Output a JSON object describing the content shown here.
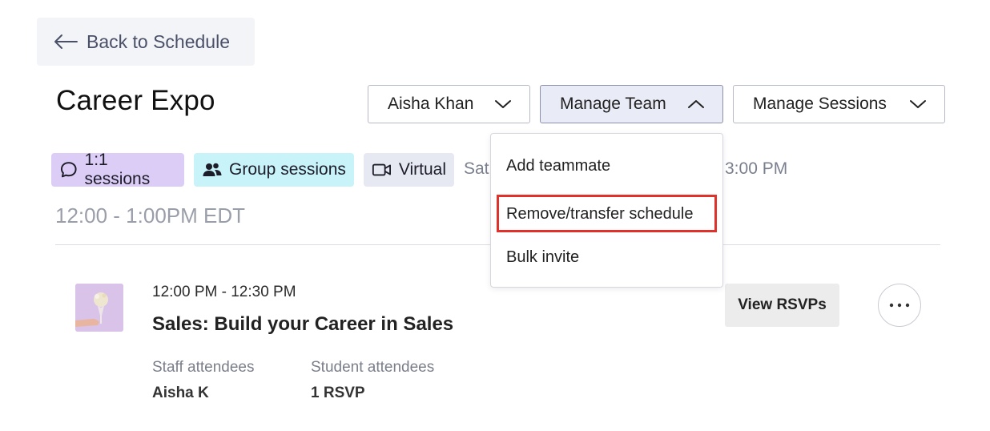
{
  "nav": {
    "back_label": "Back to Schedule"
  },
  "event": {
    "title": "Career Expo",
    "tags": [
      "1:1 sessions",
      "Group sessions",
      "Virtual"
    ],
    "date_partial_left": "Sat",
    "date_partial_right": "3:00 PM",
    "time_range": "12:00 - 1:00PM EDT"
  },
  "toolbar": {
    "user_dropdown": "Aisha Khan",
    "team_dropdown": "Manage Team",
    "sessions_dropdown": "Manage Sessions"
  },
  "team_menu": {
    "items": [
      "Add teammate",
      "Remove/transfer schedule",
      "Bulk invite"
    ],
    "highlighted_item": "Remove/transfer schedule",
    "highlight_color": "#e0322a"
  },
  "session": {
    "time": "12:00 PM - 12:30 PM",
    "title": "Sales: Build your Career in Sales",
    "staff_label": "Staff attendees",
    "staff_value": "Aisha K",
    "student_label": "Student attendees",
    "student_value": "1 RSVP",
    "rsvp_button": "View RSVPs"
  },
  "colors": {
    "tag_1on1": "#dccdf6",
    "tag_group": "#c8f3f8",
    "tag_virtual": "#e6e8f2"
  }
}
